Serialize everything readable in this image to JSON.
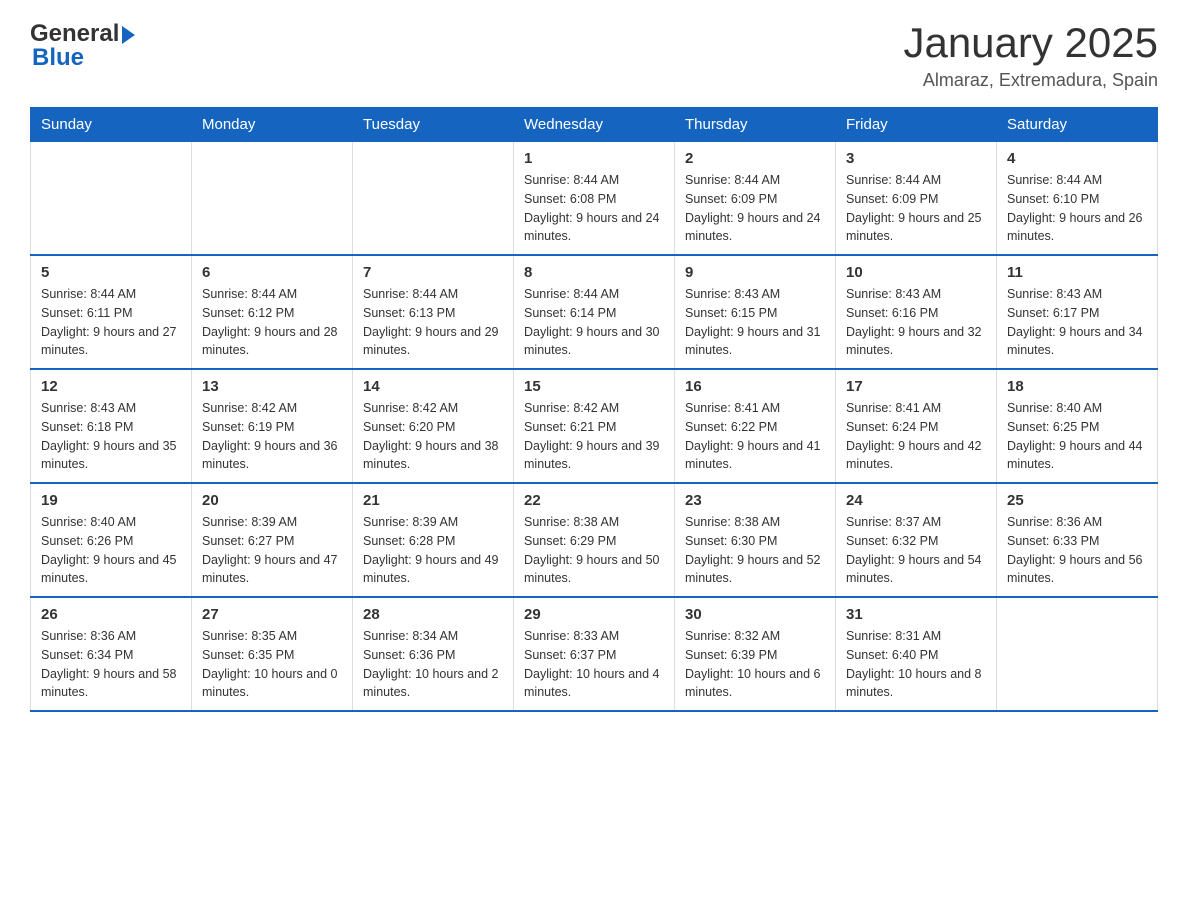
{
  "header": {
    "month_title": "January 2025",
    "location": "Almaraz, Extremadura, Spain"
  },
  "logo": {
    "part1": "General",
    "part2": "Blue"
  },
  "days_of_week": [
    "Sunday",
    "Monday",
    "Tuesday",
    "Wednesday",
    "Thursday",
    "Friday",
    "Saturday"
  ],
  "weeks": [
    [
      {
        "day": "",
        "sunrise": "",
        "sunset": "",
        "daylight": ""
      },
      {
        "day": "",
        "sunrise": "",
        "sunset": "",
        "daylight": ""
      },
      {
        "day": "",
        "sunrise": "",
        "sunset": "",
        "daylight": ""
      },
      {
        "day": "1",
        "sunrise": "Sunrise: 8:44 AM",
        "sunset": "Sunset: 6:08 PM",
        "daylight": "Daylight: 9 hours and 24 minutes."
      },
      {
        "day": "2",
        "sunrise": "Sunrise: 8:44 AM",
        "sunset": "Sunset: 6:09 PM",
        "daylight": "Daylight: 9 hours and 24 minutes."
      },
      {
        "day": "3",
        "sunrise": "Sunrise: 8:44 AM",
        "sunset": "Sunset: 6:09 PM",
        "daylight": "Daylight: 9 hours and 25 minutes."
      },
      {
        "day": "4",
        "sunrise": "Sunrise: 8:44 AM",
        "sunset": "Sunset: 6:10 PM",
        "daylight": "Daylight: 9 hours and 26 minutes."
      }
    ],
    [
      {
        "day": "5",
        "sunrise": "Sunrise: 8:44 AM",
        "sunset": "Sunset: 6:11 PM",
        "daylight": "Daylight: 9 hours and 27 minutes."
      },
      {
        "day": "6",
        "sunrise": "Sunrise: 8:44 AM",
        "sunset": "Sunset: 6:12 PM",
        "daylight": "Daylight: 9 hours and 28 minutes."
      },
      {
        "day": "7",
        "sunrise": "Sunrise: 8:44 AM",
        "sunset": "Sunset: 6:13 PM",
        "daylight": "Daylight: 9 hours and 29 minutes."
      },
      {
        "day": "8",
        "sunrise": "Sunrise: 8:44 AM",
        "sunset": "Sunset: 6:14 PM",
        "daylight": "Daylight: 9 hours and 30 minutes."
      },
      {
        "day": "9",
        "sunrise": "Sunrise: 8:43 AM",
        "sunset": "Sunset: 6:15 PM",
        "daylight": "Daylight: 9 hours and 31 minutes."
      },
      {
        "day": "10",
        "sunrise": "Sunrise: 8:43 AM",
        "sunset": "Sunset: 6:16 PM",
        "daylight": "Daylight: 9 hours and 32 minutes."
      },
      {
        "day": "11",
        "sunrise": "Sunrise: 8:43 AM",
        "sunset": "Sunset: 6:17 PM",
        "daylight": "Daylight: 9 hours and 34 minutes."
      }
    ],
    [
      {
        "day": "12",
        "sunrise": "Sunrise: 8:43 AM",
        "sunset": "Sunset: 6:18 PM",
        "daylight": "Daylight: 9 hours and 35 minutes."
      },
      {
        "day": "13",
        "sunrise": "Sunrise: 8:42 AM",
        "sunset": "Sunset: 6:19 PM",
        "daylight": "Daylight: 9 hours and 36 minutes."
      },
      {
        "day": "14",
        "sunrise": "Sunrise: 8:42 AM",
        "sunset": "Sunset: 6:20 PM",
        "daylight": "Daylight: 9 hours and 38 minutes."
      },
      {
        "day": "15",
        "sunrise": "Sunrise: 8:42 AM",
        "sunset": "Sunset: 6:21 PM",
        "daylight": "Daylight: 9 hours and 39 minutes."
      },
      {
        "day": "16",
        "sunrise": "Sunrise: 8:41 AM",
        "sunset": "Sunset: 6:22 PM",
        "daylight": "Daylight: 9 hours and 41 minutes."
      },
      {
        "day": "17",
        "sunrise": "Sunrise: 8:41 AM",
        "sunset": "Sunset: 6:24 PM",
        "daylight": "Daylight: 9 hours and 42 minutes."
      },
      {
        "day": "18",
        "sunrise": "Sunrise: 8:40 AM",
        "sunset": "Sunset: 6:25 PM",
        "daylight": "Daylight: 9 hours and 44 minutes."
      }
    ],
    [
      {
        "day": "19",
        "sunrise": "Sunrise: 8:40 AM",
        "sunset": "Sunset: 6:26 PM",
        "daylight": "Daylight: 9 hours and 45 minutes."
      },
      {
        "day": "20",
        "sunrise": "Sunrise: 8:39 AM",
        "sunset": "Sunset: 6:27 PM",
        "daylight": "Daylight: 9 hours and 47 minutes."
      },
      {
        "day": "21",
        "sunrise": "Sunrise: 8:39 AM",
        "sunset": "Sunset: 6:28 PM",
        "daylight": "Daylight: 9 hours and 49 minutes."
      },
      {
        "day": "22",
        "sunrise": "Sunrise: 8:38 AM",
        "sunset": "Sunset: 6:29 PM",
        "daylight": "Daylight: 9 hours and 50 minutes."
      },
      {
        "day": "23",
        "sunrise": "Sunrise: 8:38 AM",
        "sunset": "Sunset: 6:30 PM",
        "daylight": "Daylight: 9 hours and 52 minutes."
      },
      {
        "day": "24",
        "sunrise": "Sunrise: 8:37 AM",
        "sunset": "Sunset: 6:32 PM",
        "daylight": "Daylight: 9 hours and 54 minutes."
      },
      {
        "day": "25",
        "sunrise": "Sunrise: 8:36 AM",
        "sunset": "Sunset: 6:33 PM",
        "daylight": "Daylight: 9 hours and 56 minutes."
      }
    ],
    [
      {
        "day": "26",
        "sunrise": "Sunrise: 8:36 AM",
        "sunset": "Sunset: 6:34 PM",
        "daylight": "Daylight: 9 hours and 58 minutes."
      },
      {
        "day": "27",
        "sunrise": "Sunrise: 8:35 AM",
        "sunset": "Sunset: 6:35 PM",
        "daylight": "Daylight: 10 hours and 0 minutes."
      },
      {
        "day": "28",
        "sunrise": "Sunrise: 8:34 AM",
        "sunset": "Sunset: 6:36 PM",
        "daylight": "Daylight: 10 hours and 2 minutes."
      },
      {
        "day": "29",
        "sunrise": "Sunrise: 8:33 AM",
        "sunset": "Sunset: 6:37 PM",
        "daylight": "Daylight: 10 hours and 4 minutes."
      },
      {
        "day": "30",
        "sunrise": "Sunrise: 8:32 AM",
        "sunset": "Sunset: 6:39 PM",
        "daylight": "Daylight: 10 hours and 6 minutes."
      },
      {
        "day": "31",
        "sunrise": "Sunrise: 8:31 AM",
        "sunset": "Sunset: 6:40 PM",
        "daylight": "Daylight: 10 hours and 8 minutes."
      },
      {
        "day": "",
        "sunrise": "",
        "sunset": "",
        "daylight": ""
      }
    ]
  ]
}
